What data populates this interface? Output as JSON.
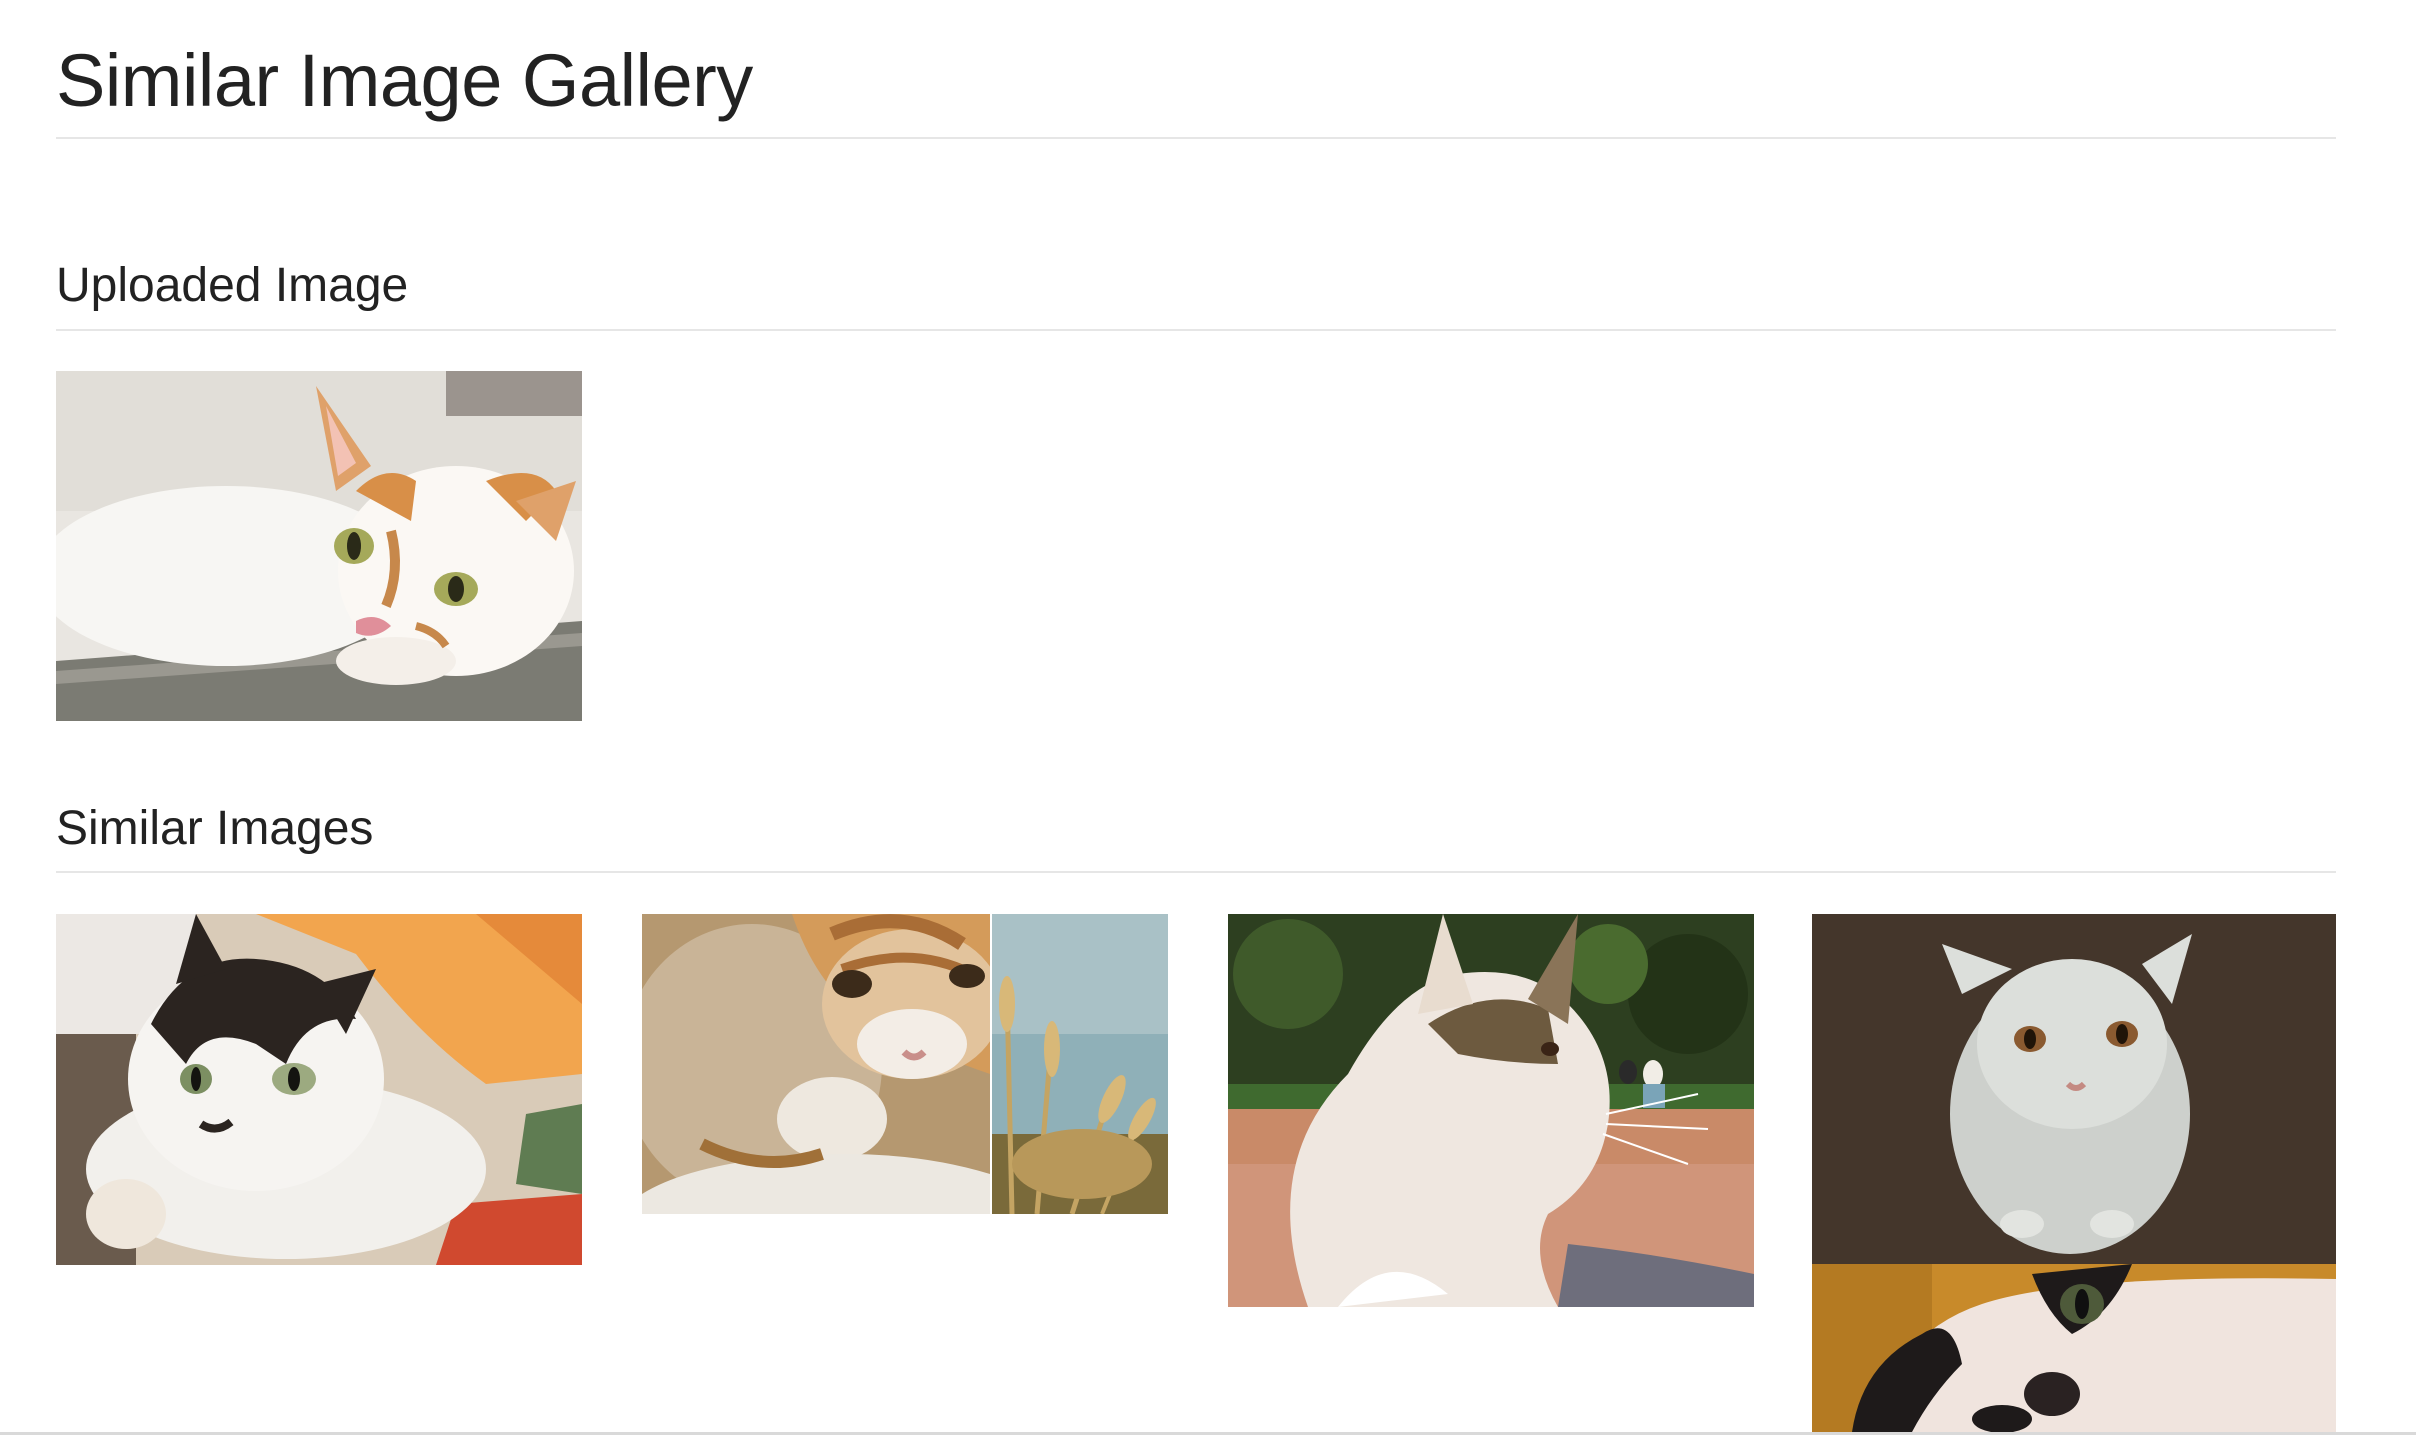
{
  "page": {
    "title": "Similar Image Gallery"
  },
  "uploaded": {
    "heading": "Uploaded Image",
    "image": {
      "name": "uploaded-cat-photo",
      "description_icon": "cat-photo",
      "colors": [
        "#f2f0ed",
        "#d98f4a",
        "#7a7a73"
      ]
    }
  },
  "similar": {
    "heading": "Similar Images",
    "images": [
      {
        "name": "similar-image-1",
        "description_icon": "cat-photo"
      },
      {
        "name": "similar-image-2",
        "description_icon": "cat-photo"
      },
      {
        "name": "similar-image-3",
        "description_icon": "cat-photo"
      },
      {
        "name": "similar-image-4",
        "description_icon": "cat-photo"
      }
    ]
  },
  "colors": {
    "text": "#222222",
    "divider": "#e6e6e6",
    "background": "#ffffff"
  }
}
